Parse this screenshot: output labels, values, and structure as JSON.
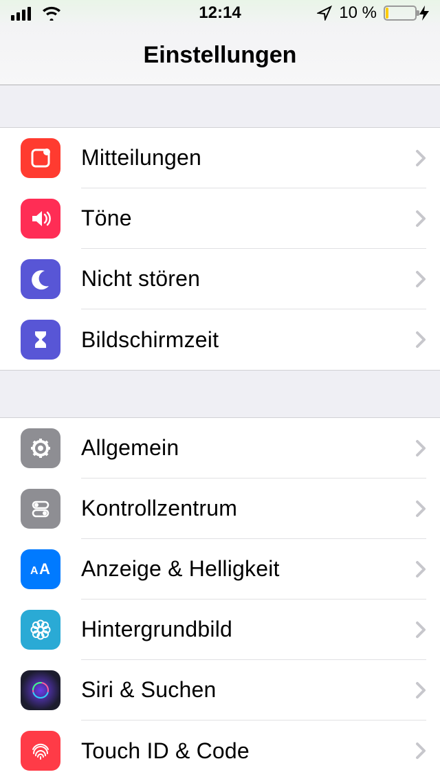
{
  "status": {
    "time": "12:14",
    "battery_text": "10 %",
    "battery_level": 10
  },
  "header": {
    "title": "Einstellungen"
  },
  "groups": [
    {
      "rows": [
        {
          "id": "notifications",
          "label": "Mitteilungen",
          "icon": "notifications-icon",
          "color": "ic-red"
        },
        {
          "id": "sounds",
          "label": "Töne",
          "icon": "sounds-icon",
          "color": "ic-pink"
        },
        {
          "id": "dnd",
          "label": "Nicht stören",
          "icon": "moon-icon",
          "color": "ic-indigo"
        },
        {
          "id": "screentime",
          "label": "Bildschirmzeit",
          "icon": "hourglass-icon",
          "color": "ic-indigo"
        }
      ]
    },
    {
      "rows": [
        {
          "id": "general",
          "label": "Allgemein",
          "icon": "gear-icon",
          "color": "ic-gray"
        },
        {
          "id": "controlcenter",
          "label": "Kontrollzentrum",
          "icon": "toggles-icon",
          "color": "ic-gray"
        },
        {
          "id": "display",
          "label": "Anzeige & Helligkeit",
          "icon": "display-icon",
          "color": "ic-blue"
        },
        {
          "id": "wallpaper",
          "label": "Hintergrundbild",
          "icon": "flower-icon",
          "color": "ic-cyan"
        },
        {
          "id": "siri",
          "label": "Siri & Suchen",
          "icon": "siri-icon",
          "color": "ic-dark"
        },
        {
          "id": "touchid",
          "label": "Touch ID & Code",
          "icon": "fingerprint-icon",
          "color": "ic-red2"
        }
      ]
    }
  ]
}
